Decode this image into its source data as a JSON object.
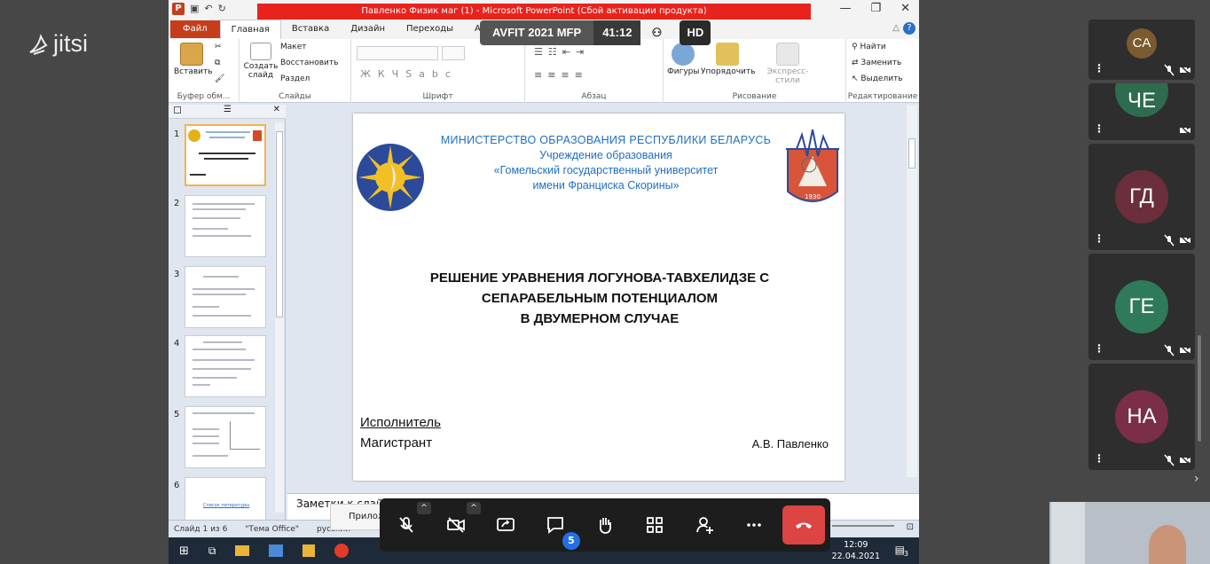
{
  "jitsi": {
    "logo_text": "jitsi"
  },
  "meeting": {
    "name": "AVFIT 2021 MFP",
    "timer": "41:12",
    "quality": "HD"
  },
  "ppt": {
    "window_title": "Павленко Физик маг (1)  -  Microsoft PowerPoint (Сбой активации продукта)",
    "tabs": [
      "Файл",
      "Главная",
      "Вставка",
      "Дизайн",
      "Переходы",
      "Анимация"
    ],
    "active_tab": "Главная",
    "ribbon": {
      "paste": "Вставить",
      "clipboard_group": "Буфер обм...",
      "new_slide": "Создать слайд",
      "layout": "Макет",
      "reset": "Восстановить",
      "section": "Раздел",
      "slides_group": "Слайды",
      "font_group": "Шрифт",
      "paragraph_group": "Абзац",
      "shapes": "Фигуры",
      "arrange": "Упорядочить",
      "quick_styles": "Экспресс-стили",
      "drawing_group": "Рисование",
      "find": "Найти",
      "replace": "Заменить",
      "select": "Выделить",
      "editing_group": "Редактирование"
    },
    "thumb_numbers": [
      "1",
      "2",
      "3",
      "4",
      "5",
      "6"
    ],
    "thumb6_link": "Список литературы",
    "slide": {
      "ministry": "МИНИСТЕРСТВО  ОБРАЗОВАНИЯ  РЕСПУБЛИКИ  БЕЛАРУСЬ",
      "institution": "Учреждение образования",
      "university": "«Гомельский государственный университет",
      "named": "имени Франциска Скорины»",
      "title_l1": "РЕШЕНИЕ УРАВНЕНИЯ ЛОГУНОВА-ТАВХЕЛИДЗЕ С",
      "title_l2": "СЕПАРАБЕЛЬНЫМ  ПОТЕНЦИАЛОМ",
      "title_l3": "В ДВУМЕРНОМ СЛУЧАЕ",
      "executor": "Исполнитель",
      "master": "Магистрант",
      "author": "А.В. Павленко",
      "emblem_year": "1930"
    },
    "notes_placeholder": "Заметки к слайду",
    "status": {
      "slide": "Слайд 1 из 6",
      "theme": "\"Тема Office\"",
      "lang": "русский"
    }
  },
  "participants": [
    {
      "initials": "CA",
      "color": "#7a5a2e"
    },
    {
      "initials": "ЧЕ",
      "color": "#2e6b4f"
    },
    {
      "initials": "ГД",
      "color": "#6a2e3c"
    },
    {
      "initials": "ГЕ",
      "color": "#2e7a5a"
    },
    {
      "initials": "НА",
      "color": "#7a2e48"
    }
  ],
  "toolbar": {
    "chat_badge": "5",
    "popup_label": "Прилож"
  },
  "taskbar": {
    "time": "12:09",
    "date": "22.04.2021",
    "notif": "3"
  }
}
